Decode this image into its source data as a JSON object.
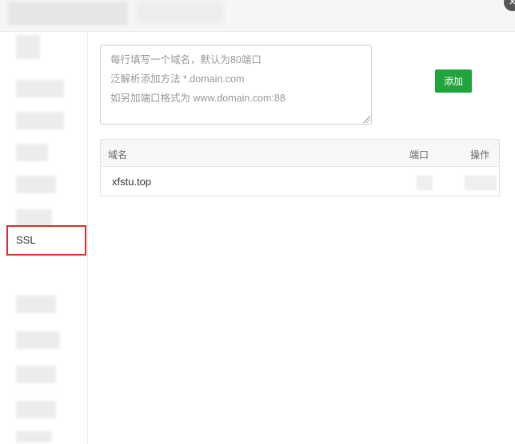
{
  "dialog": {
    "close_icon": "close-icon",
    "close_glyph": "×"
  },
  "sidebar": {
    "ssl_label": "SSL"
  },
  "domain_input": {
    "placeholder_lines": [
      "每行填写一个域名，默认为80端口",
      "泛解析添加方法 *.domain.com",
      "如另加端口格式为 www.domain.com:88"
    ]
  },
  "toolbar": {
    "add_label": "添加",
    "add_color": "#20a53a"
  },
  "table": {
    "headers": {
      "domain": "域名",
      "port": "端口",
      "operation": "操作"
    },
    "rows": [
      {
        "domain": "xfstu.top"
      }
    ]
  },
  "colors": {
    "highlight_border": "#e02b2b",
    "header_bg": "#f6f7f9"
  }
}
